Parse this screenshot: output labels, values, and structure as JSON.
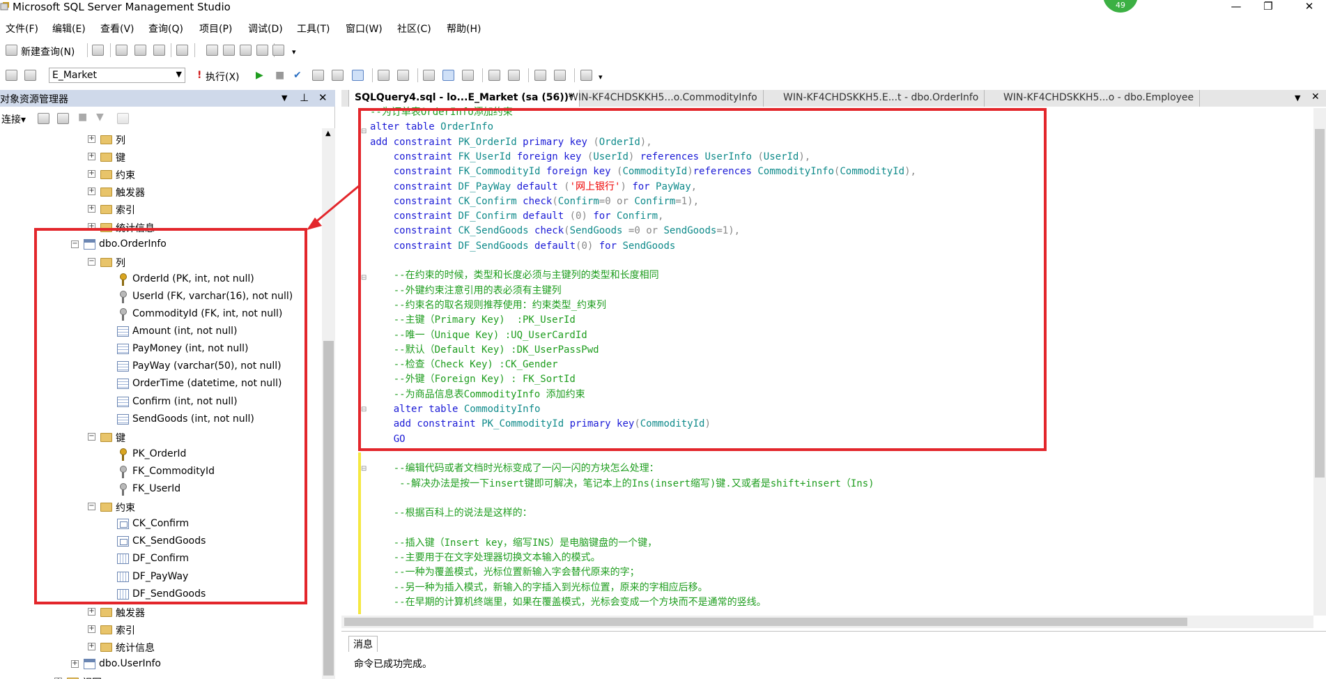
{
  "window": {
    "title": "Microsoft SQL Server Management Studio",
    "badge": "49",
    "minimize": "—",
    "restore": "❐",
    "close": "✕"
  },
  "menu": [
    "文件(F)",
    "编辑(E)",
    "查看(V)",
    "查询(Q)",
    "项目(P)",
    "调试(D)",
    "工具(T)",
    "窗口(W)",
    "社区(C)",
    "帮助(H)"
  ],
  "toolbar1": {
    "new_query": "新建查询(N)"
  },
  "toolbar2": {
    "database": "E_Market",
    "execute": "执行(X)"
  },
  "explorer": {
    "title": "对象资源管理器",
    "connect": "连接▾",
    "tree": [
      {
        "label": "列",
        "indent": 1,
        "icon": "folder",
        "exp": "+"
      },
      {
        "label": "键",
        "indent": 1,
        "icon": "folder",
        "exp": "+"
      },
      {
        "label": "约束",
        "indent": 1,
        "icon": "folder",
        "exp": "+"
      },
      {
        "label": "触发器",
        "indent": 1,
        "icon": "folder",
        "exp": "+"
      },
      {
        "label": "索引",
        "indent": 1,
        "icon": "folder",
        "exp": "+"
      },
      {
        "label": "统计信息",
        "indent": 1,
        "icon": "folder",
        "exp": "+"
      },
      {
        "label": "dbo.OrderInfo",
        "indent": 0,
        "icon": "table",
        "exp": "−"
      },
      {
        "label": "列",
        "indent": 1,
        "icon": "folder",
        "exp": "−"
      },
      {
        "label": "OrderId (PK, int, not null)",
        "indent": 2,
        "icon": "key",
        "exp": ""
      },
      {
        "label": "UserId (FK, varchar(16), not null)",
        "indent": 2,
        "icon": "key gray",
        "exp": ""
      },
      {
        "label": "CommodityId (FK, int, not null)",
        "indent": 2,
        "icon": "key gray",
        "exp": ""
      },
      {
        "label": "Amount (int, not null)",
        "indent": 2,
        "icon": "column",
        "exp": ""
      },
      {
        "label": "PayMoney (int, not null)",
        "indent": 2,
        "icon": "column",
        "exp": ""
      },
      {
        "label": "PayWay (varchar(50), not null)",
        "indent": 2,
        "icon": "column",
        "exp": ""
      },
      {
        "label": "OrderTime (datetime, not null)",
        "indent": 2,
        "icon": "column",
        "exp": ""
      },
      {
        "label": "Confirm (int, not null)",
        "indent": 2,
        "icon": "column",
        "exp": ""
      },
      {
        "label": "SendGoods (int, not null)",
        "indent": 2,
        "icon": "column",
        "exp": ""
      },
      {
        "label": "键",
        "indent": 1,
        "icon": "folder",
        "exp": "−"
      },
      {
        "label": "PK_OrderId",
        "indent": 2,
        "icon": "key",
        "exp": ""
      },
      {
        "label": "FK_CommodityId",
        "indent": 2,
        "icon": "key gray",
        "exp": ""
      },
      {
        "label": "FK_UserId",
        "indent": 2,
        "icon": "key gray",
        "exp": ""
      },
      {
        "label": "约束",
        "indent": 1,
        "icon": "folder",
        "exp": "−"
      },
      {
        "label": "CK_Confirm",
        "indent": 2,
        "icon": "check",
        "exp": ""
      },
      {
        "label": "CK_SendGoods",
        "indent": 2,
        "icon": "check",
        "exp": ""
      },
      {
        "label": "DF_Confirm",
        "indent": 2,
        "icon": "default",
        "exp": ""
      },
      {
        "label": "DF_PayWay",
        "indent": 2,
        "icon": "default",
        "exp": ""
      },
      {
        "label": "DF_SendGoods",
        "indent": 2,
        "icon": "default",
        "exp": ""
      },
      {
        "label": "触发器",
        "indent": 1,
        "icon": "folder",
        "exp": "+"
      },
      {
        "label": "索引",
        "indent": 1,
        "icon": "folder",
        "exp": "+"
      },
      {
        "label": "统计信息",
        "indent": 1,
        "icon": "folder",
        "exp": "+"
      },
      {
        "label": "dbo.UserInfo",
        "indent": 0,
        "icon": "table",
        "exp": "+"
      },
      {
        "label": "视图",
        "indent": -1,
        "icon": "folder",
        "exp": "+"
      }
    ]
  },
  "tabs": [
    {
      "label": "SQLQuery4.sql - lo...E_Market (sa (56))*",
      "active": true
    },
    {
      "label": "WIN-KF4CHDSKKH5...o.CommodityInfo",
      "active": false
    },
    {
      "label": "WIN-KF4CHDSKKH5.E...t - dbo.OrderInfo",
      "active": false
    },
    {
      "label": "WIN-KF4CHDSKKH5...o - dbo.Employee",
      "active": false
    }
  ],
  "code_lines": [
    [
      [
        "cm",
        "--为订单表OrderInfo添加约束"
      ]
    ],
    [
      [
        "kw",
        "alter table "
      ],
      [
        "id",
        "OrderInfo"
      ]
    ],
    [
      [
        "kw",
        "add constraint "
      ],
      [
        "id",
        "PK_OrderId "
      ],
      [
        "kw",
        "primary key "
      ],
      [
        "gr",
        "("
      ],
      [
        "id",
        "OrderId"
      ],
      [
        "gr",
        "),"
      ]
    ],
    [
      [
        "pl",
        "    "
      ],
      [
        "kw",
        "constraint "
      ],
      [
        "id",
        "FK_UserId "
      ],
      [
        "kw",
        "foreign key "
      ],
      [
        "gr",
        "("
      ],
      [
        "id",
        "UserId"
      ],
      [
        "gr",
        ") "
      ],
      [
        "kw",
        "references "
      ],
      [
        "id",
        "UserInfo "
      ],
      [
        "gr",
        "("
      ],
      [
        "id",
        "UserId"
      ],
      [
        "gr",
        "),"
      ]
    ],
    [
      [
        "pl",
        "    "
      ],
      [
        "kw",
        "constraint "
      ],
      [
        "id",
        "FK_CommodityId "
      ],
      [
        "kw",
        "foreign key "
      ],
      [
        "gr",
        "("
      ],
      [
        "id",
        "CommodityId"
      ],
      [
        "gr",
        ")"
      ],
      [
        "kw",
        "references "
      ],
      [
        "id",
        "CommodityInfo"
      ],
      [
        "gr",
        "("
      ],
      [
        "id",
        "CommodityId"
      ],
      [
        "gr",
        "),"
      ]
    ],
    [
      [
        "pl",
        "    "
      ],
      [
        "kw",
        "constraint "
      ],
      [
        "id",
        "DF_PayWay "
      ],
      [
        "kw",
        "default "
      ],
      [
        "gr",
        "("
      ],
      [
        "st",
        "'网上银行'"
      ],
      [
        "gr",
        ") "
      ],
      [
        "kw",
        "for "
      ],
      [
        "id",
        "PayWay"
      ],
      [
        "gr",
        ","
      ]
    ],
    [
      [
        "pl",
        "    "
      ],
      [
        "kw",
        "constraint "
      ],
      [
        "id",
        "CK_Confirm "
      ],
      [
        "kw",
        "check"
      ],
      [
        "gr",
        "("
      ],
      [
        "id",
        "Confirm"
      ],
      [
        "gr",
        "=0 or "
      ],
      [
        "id",
        "Confirm"
      ],
      [
        "gr",
        "=1),"
      ]
    ],
    [
      [
        "pl",
        "    "
      ],
      [
        "kw",
        "constraint "
      ],
      [
        "id",
        "DF_Confirm "
      ],
      [
        "kw",
        "default "
      ],
      [
        "gr",
        "(0) "
      ],
      [
        "kw",
        "for "
      ],
      [
        "id",
        "Confirm"
      ],
      [
        "gr",
        ","
      ]
    ],
    [
      [
        "pl",
        "    "
      ],
      [
        "kw",
        "constraint "
      ],
      [
        "id",
        "CK_SendGoods "
      ],
      [
        "kw",
        "check"
      ],
      [
        "gr",
        "("
      ],
      [
        "id",
        "SendGoods "
      ],
      [
        "gr",
        "=0 or "
      ],
      [
        "id",
        "SendGoods"
      ],
      [
        "gr",
        "=1),"
      ]
    ],
    [
      [
        "pl",
        "    "
      ],
      [
        "kw",
        "constraint "
      ],
      [
        "id",
        "DF_SendGoods "
      ],
      [
        "kw",
        "default"
      ],
      [
        "gr",
        "(0) "
      ],
      [
        "kw",
        "for "
      ],
      [
        "id",
        "SendGoods"
      ]
    ],
    [
      [
        "pl",
        ""
      ]
    ],
    [
      [
        "pl",
        "    "
      ],
      [
        "cm",
        "--在约束的时候，类型和长度必须与主键列的类型和长度相同"
      ]
    ],
    [
      [
        "pl",
        "    "
      ],
      [
        "cm",
        "--外键约束注意引用的表必须有主键列"
      ]
    ],
    [
      [
        "pl",
        "    "
      ],
      [
        "cm",
        "--约束名的取名规则推荐使用：约束类型_约束列"
      ]
    ],
    [
      [
        "pl",
        "    "
      ],
      [
        "cm",
        "--主键（Primary Key)  :PK_UserId"
      ]
    ],
    [
      [
        "pl",
        "    "
      ],
      [
        "cm",
        "--唯一（Unique Key) :UQ_UserCardId"
      ]
    ],
    [
      [
        "pl",
        "    "
      ],
      [
        "cm",
        "--默认（Default Key) :DK_UserPassPwd"
      ]
    ],
    [
      [
        "pl",
        "    "
      ],
      [
        "cm",
        "--检查（Check Key) :CK_Gender"
      ]
    ],
    [
      [
        "pl",
        "    "
      ],
      [
        "cm",
        "--外键（Foreign Key) : FK_SortId"
      ]
    ],
    [
      [
        "pl",
        "    "
      ],
      [
        "cm",
        "--为商品信息表CommodityInfo 添加约束"
      ]
    ],
    [
      [
        "pl",
        "    "
      ],
      [
        "kw",
        "alter table "
      ],
      [
        "id",
        "CommodityInfo"
      ]
    ],
    [
      [
        "pl",
        "    "
      ],
      [
        "kw",
        "add constraint "
      ],
      [
        "id",
        "PK_CommodityId "
      ],
      [
        "kw",
        "primary key"
      ],
      [
        "gr",
        "("
      ],
      [
        "id",
        "CommodityId"
      ],
      [
        "gr",
        ")"
      ]
    ],
    [
      [
        "pl",
        "    "
      ],
      [
        "kw",
        "GO"
      ]
    ],
    [
      [
        "pl",
        ""
      ]
    ],
    [
      [
        "pl",
        "    "
      ],
      [
        "cm",
        "--编辑代码或者文档时光标变成了一闪一闪的方块怎么处理："
      ]
    ],
    [
      [
        "pl",
        "     "
      ],
      [
        "cm",
        "--解决办法是按一下insert键即可解决，笔记本上的Ins(insert缩写)键.又或者是shift+insert（Ins)"
      ]
    ],
    [
      [
        "pl",
        ""
      ]
    ],
    [
      [
        "pl",
        "    "
      ],
      [
        "cm",
        "--根据百科上的说法是这样的："
      ]
    ],
    [
      [
        "pl",
        ""
      ]
    ],
    [
      [
        "pl",
        "    "
      ],
      [
        "cm",
        "--插入键（Insert key，缩写INS）是电脑键盘的一个键，"
      ]
    ],
    [
      [
        "pl",
        "    "
      ],
      [
        "cm",
        "--主要用于在文字处理器切换文本输入的模式。"
      ]
    ],
    [
      [
        "pl",
        "    "
      ],
      [
        "cm",
        "--一种为覆盖模式，光标位置新输入字会替代原来的字；"
      ]
    ],
    [
      [
        "pl",
        "    "
      ],
      [
        "cm",
        "--另一种为插入模式，新输入的字插入到光标位置，原来的字相应后移。"
      ]
    ],
    [
      [
        "pl",
        "    "
      ],
      [
        "cm",
        "--在早期的计算机终端里，如果在覆盖模式，光标会变成一个方块而不是通常的竖线。"
      ]
    ]
  ],
  "messages": {
    "tab": "消息",
    "text": "命令已成功完成。"
  }
}
